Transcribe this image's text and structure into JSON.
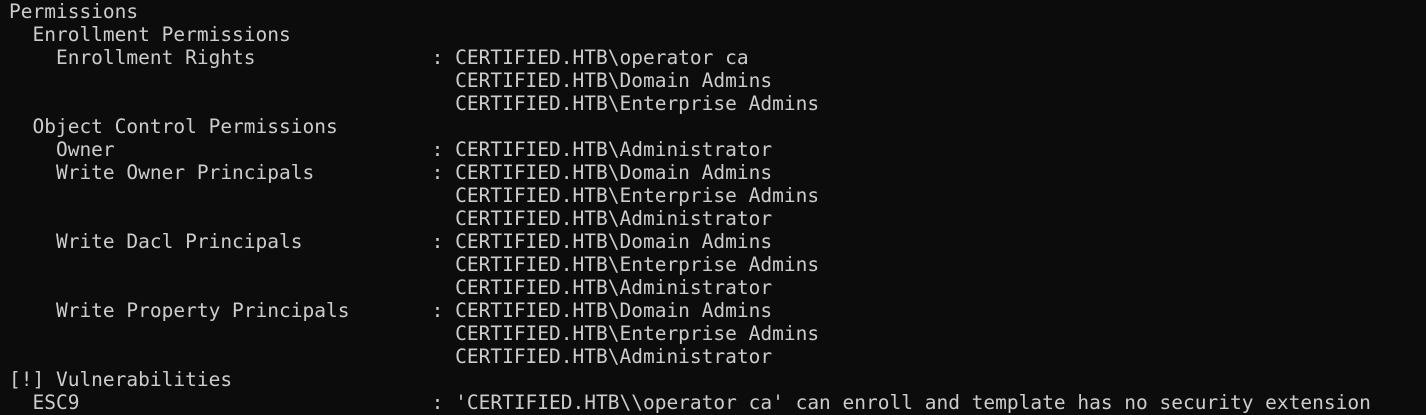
{
  "terminal": {
    "lines": [
      "Permissions",
      "  Enrollment Permissions",
      "    Enrollment Rights               : CERTIFIED.HTB\\operator ca",
      "                                      CERTIFIED.HTB\\Domain Admins",
      "                                      CERTIFIED.HTB\\Enterprise Admins",
      "  Object Control Permissions",
      "    Owner                           : CERTIFIED.HTB\\Administrator",
      "    Write Owner Principals          : CERTIFIED.HTB\\Domain Admins",
      "                                      CERTIFIED.HTB\\Enterprise Admins",
      "                                      CERTIFIED.HTB\\Administrator",
      "    Write Dacl Principals           : CERTIFIED.HTB\\Domain Admins",
      "                                      CERTIFIED.HTB\\Enterprise Admins",
      "                                      CERTIFIED.HTB\\Administrator",
      "    Write Property Principals       : CERTIFIED.HTB\\Domain Admins",
      "                                      CERTIFIED.HTB\\Enterprise Admins",
      "                                      CERTIFIED.HTB\\Administrator",
      "[!] Vulnerabilities",
      "  ESC9                              : 'CERTIFIED.HTB\\\\operator ca' can enroll and template has no security extension"
    ]
  }
}
